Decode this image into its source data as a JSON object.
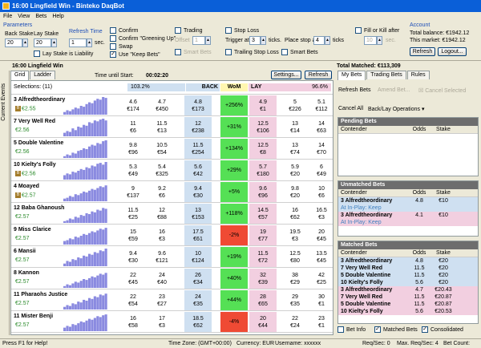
{
  "window": {
    "title": "16:00 Lingfield Win - Binteko DaqBot"
  },
  "menu": [
    "File",
    "View",
    "Bets",
    "Help"
  ],
  "toolbar": {
    "parameters_label": "Parameters",
    "back_stake_label": "Back Stake",
    "back_stake_value": "20",
    "lay_stake_label": "Lay Stake",
    "lay_stake_value": "20",
    "refresh_time_label": "Refresh Time",
    "refresh_time_value": "1",
    "sec_label": "sec.",
    "lay_is_liability": "Lay Stake is Liability",
    "confirm": "Confirm",
    "confirm_greening": "Confirm \"Greening Up\"",
    "swap": "Swap",
    "use_keep_bets": "Use \"Keep Bets\"",
    "trading": "Trading",
    "offset_label": "Offset",
    "offset_value": "1",
    "smart_bets_disabled": "Smart Bets",
    "stop_loss": "Stop Loss",
    "trigger_label": "Trigger at",
    "trigger_value": "3",
    "ticks_label": "ticks.",
    "place_stop_label": "Place stop at",
    "place_stop_value": "4",
    "ticks_label2": "ticks",
    "trailing_stop": "Trailing Stop Loss",
    "smart_bets": "Smart Bets",
    "fill_or_kill": "Fill or Kill after",
    "fok_value": "10",
    "fok_sec": "sec.",
    "account_label": "Account",
    "total_balance": "Total balance: €1942.12",
    "this_market": "This market: €1942.12",
    "refresh_btn": "Refresh",
    "logout_btn": "Logout..."
  },
  "market": {
    "name": "16:00 Lingfield Win",
    "total_matched": "Total Matched: €113,309"
  },
  "grid": {
    "tabs": [
      "Grid",
      "Ladder"
    ],
    "time_until_start_label": "Time until Start:",
    "time_until_start": "00:02:20",
    "settings_btn": "Settings...",
    "refresh_btn": "Refresh",
    "selections": "Selections: (11)",
    "back_pct": "103.2%",
    "back_label": "BACK",
    "wom_label": "WoM",
    "lay_label": "LAY",
    "lay_pct": "96.6%"
  },
  "runners": [
    {
      "name": "3 Alfredtheordinary",
      "pl": "€2.55",
      "badge": true,
      "back": [
        [
          "4.6",
          "€174"
        ],
        [
          "4.7",
          "€450"
        ],
        [
          "4.8",
          "€173"
        ]
      ],
      "wom": "+256%",
      "wom_sign": "pos",
      "lay": [
        [
          "4.9",
          "€1"
        ],
        [
          "5",
          "€226"
        ],
        [
          "5.1",
          "€112"
        ]
      ],
      "spark": [
        3,
        5,
        4,
        6,
        8,
        7,
        10,
        9,
        12,
        14,
        13,
        16,
        18,
        17,
        20,
        19
      ]
    },
    {
      "name": "7 Very Well Red",
      "pl": "€2.56",
      "badge": false,
      "back": [
        [
          "11",
          "€6"
        ],
        [
          "11.5",
          "€13"
        ],
        [
          "12",
          "€238"
        ]
      ],
      "wom": "+31%",
      "wom_sign": "pos",
      "lay": [
        [
          "12.5",
          "€106"
        ],
        [
          "13",
          "€14"
        ],
        [
          "14",
          "€63"
        ]
      ],
      "spark": [
        4,
        6,
        5,
        9,
        7,
        11,
        10,
        13,
        12,
        16,
        15,
        18,
        17,
        19,
        20,
        18
      ]
    },
    {
      "name": "5 Double Valentine",
      "pl": "€2.56",
      "badge": false,
      "back": [
        [
          "9.8",
          "€96"
        ],
        [
          "10.5",
          "€54"
        ],
        [
          "11.5",
          "€254"
        ]
      ],
      "wom": "+134%",
      "wom_sign": "pos",
      "lay": [
        [
          "12.5",
          "€8"
        ],
        [
          "13",
          "€74"
        ],
        [
          "14",
          "€70"
        ]
      ],
      "spark": [
        2,
        4,
        3,
        6,
        5,
        8,
        9,
        11,
        10,
        13,
        15,
        14,
        17,
        16,
        19,
        20
      ]
    },
    {
      "name": "10 Kielty's Folly",
      "pl": "€2.56",
      "badge": true,
      "back": [
        [
          "5.3",
          "€49"
        ],
        [
          "5.4",
          "€325"
        ],
        [
          "5.6",
          "€42"
        ]
      ],
      "wom": "+29%",
      "wom_sign": "pos",
      "lay": [
        [
          "5.7",
          "€180"
        ],
        [
          "5.9",
          "€20"
        ],
        [
          "6",
          "€49"
        ]
      ],
      "spark": [
        5,
        7,
        6,
        9,
        8,
        10,
        12,
        11,
        14,
        13,
        16,
        15,
        18,
        19,
        17,
        20
      ]
    },
    {
      "name": "4 Moayed",
      "pl": "€2.57",
      "badge": true,
      "back": [
        [
          "9",
          "€137"
        ],
        [
          "9.2",
          "€6"
        ],
        [
          "9.4",
          "€30"
        ]
      ],
      "wom": "+5%",
      "wom_sign": "pos",
      "lay": [
        [
          "9.6",
          "€96"
        ],
        [
          "9.8",
          "€20"
        ],
        [
          "10",
          "€6"
        ]
      ],
      "spark": [
        3,
        4,
        6,
        5,
        8,
        7,
        9,
        11,
        10,
        12,
        14,
        13,
        15,
        17,
        16,
        18
      ]
    },
    {
      "name": "12 Baba Ghanoush",
      "pl": "€2.57",
      "badge": false,
      "back": [
        [
          "11.5",
          "€25"
        ],
        [
          "12",
          "€88"
        ],
        [
          "13",
          "€153"
        ]
      ],
      "wom": "+118%",
      "wom_sign": "pos",
      "lay": [
        [
          "14.5",
          "€57"
        ],
        [
          "16",
          "€62"
        ],
        [
          "16.5",
          "€3"
        ]
      ],
      "spark": [
        2,
        3,
        5,
        4,
        7,
        6,
        9,
        8,
        11,
        10,
        13,
        12,
        15,
        14,
        17,
        16
      ]
    },
    {
      "name": "9 Miss Clarice",
      "pl": "€2.57",
      "badge": false,
      "back": [
        [
          "15",
          "€59"
        ],
        [
          "16",
          "€3"
        ],
        [
          "17.5",
          "€61"
        ]
      ],
      "wom": "-2%",
      "wom_sign": "neg",
      "lay": [
        [
          "19",
          "€77"
        ],
        [
          "19.5",
          "€3"
        ],
        [
          "20",
          "€45"
        ]
      ],
      "spark": [
        4,
        5,
        7,
        6,
        9,
        8,
        10,
        12,
        11,
        13,
        15,
        14,
        16,
        18,
        17,
        19
      ]
    },
    {
      "name": "6 Mansii",
      "pl": "€2.57",
      "badge": false,
      "back": [
        [
          "9.4",
          "€30"
        ],
        [
          "9.6",
          "€121"
        ],
        [
          "10",
          "€124"
        ]
      ],
      "wom": "+19%",
      "wom_sign": "pos",
      "lay": [
        [
          "11.5",
          "€72"
        ],
        [
          "12.5",
          "€80"
        ],
        [
          "13.5",
          "€45"
        ]
      ],
      "spark": [
        3,
        6,
        5,
        8,
        7,
        10,
        9,
        12,
        11,
        14,
        13,
        16,
        15,
        18,
        17,
        20
      ]
    },
    {
      "name": "8 Kannon",
      "pl": "€2.57",
      "badge": false,
      "back": [
        [
          "22",
          "€45"
        ],
        [
          "24",
          "€40"
        ],
        [
          "26",
          "€34"
        ]
      ],
      "wom": "+40%",
      "wom_sign": "pos",
      "lay": [
        [
          "32",
          "€39"
        ],
        [
          "38",
          "€29"
        ],
        [
          "42",
          "€25"
        ]
      ],
      "spark": [
        2,
        4,
        3,
        5,
        7,
        6,
        8,
        10,
        9,
        11,
        13,
        12,
        14,
        16,
        15,
        17
      ]
    },
    {
      "name": "11 Pharaohs Justice",
      "pl": "€2.57",
      "badge": false,
      "back": [
        [
          "22",
          "€54"
        ],
        [
          "23",
          "€27"
        ],
        [
          "24",
          "€35"
        ]
      ],
      "wom": "+44%",
      "wom_sign": "pos",
      "lay": [
        [
          "28",
          "€65"
        ],
        [
          "29",
          "€35"
        ],
        [
          "30",
          "€1"
        ]
      ],
      "spark": [
        3,
        5,
        4,
        7,
        6,
        9,
        8,
        11,
        10,
        13,
        12,
        15,
        14,
        17,
        16,
        18
      ]
    },
    {
      "name": "11 Mister Benji",
      "pl": "€2.57",
      "badge": false,
      "back": [
        [
          "16",
          "€58"
        ],
        [
          "17",
          "€3"
        ],
        [
          "18.5",
          "€62"
        ]
      ],
      "wom": "-4%",
      "wom_sign": "neg",
      "lay": [
        [
          "20",
          "€44"
        ],
        [
          "22",
          "€24"
        ],
        [
          "23",
          "€1"
        ]
      ],
      "spark": [
        4,
        6,
        5,
        8,
        7,
        9,
        11,
        10,
        12,
        14,
        13,
        15,
        17,
        16,
        18,
        19
      ]
    }
  ],
  "right": {
    "tabs": [
      "My Bets",
      "Trading Bets",
      "Rules"
    ],
    "refresh_bets": "Refresh Bets",
    "amend_bet": "Amend Bet...",
    "cancel_selected": "Cancel Selected",
    "cancel_all": "Cancel All",
    "back_lay_ops": "Back/Lay Operations",
    "pending_title": "Pending Bets",
    "col_contender": "Contender",
    "col_odds": "Odds",
    "col_stake": "Stake",
    "unmatched_title": "Unmatched Bets",
    "unmatched": [
      {
        "type": "b",
        "name": "3 Alfredtheordinary",
        "odds": "4.8",
        "stake": "€10",
        "sub": "At In-Play: Keep"
      },
      {
        "type": "l",
        "name": "3 Alfredtheordinary",
        "odds": "4.1",
        "stake": "€10",
        "sub": "At In-Play: Keep"
      }
    ],
    "matched_title": "Matched Bets",
    "matched": [
      {
        "type": "b",
        "name": "3 Alfredtheordinary",
        "odds": "4.8",
        "stake": "€20"
      },
      {
        "type": "b",
        "name": "7 Very Well Red",
        "odds": "11.5",
        "stake": "€20"
      },
      {
        "type": "b",
        "name": "5 Double Valentine",
        "odds": "11.5",
        "stake": "€20"
      },
      {
        "type": "b",
        "name": "10 Kielty's Folly",
        "odds": "5.6",
        "stake": "€20"
      },
      {
        "type": "l",
        "name": "3 Alfredtheordinary",
        "odds": "4.7",
        "stake": "€20.43"
      },
      {
        "type": "l",
        "name": "7 Very Well Red",
        "odds": "11.5",
        "stake": "€20.87"
      },
      {
        "type": "l",
        "name": "5 Double Valentine",
        "odds": "11.5",
        "stake": "€20.87"
      },
      {
        "type": "l",
        "name": "10 Kielty's Folly",
        "odds": "5.6",
        "stake": "€20.53"
      }
    ],
    "bet_info": "Bet Info",
    "matched_bets": "Matched Bets",
    "consolidated": "Consolidated"
  },
  "vertical_tab": "Current Events",
  "status": {
    "help": "Press F1 for Help!",
    "timezone": "Time Zone: (GMT+00:00)",
    "currency": "Currency: EUR",
    "username": "Username: xxxxxx",
    "req_sec": "Req/Sec: 0",
    "max_req": "Max. Req/Sec: 4",
    "bet_count": "Bet Count:"
  },
  "colors": {
    "back": "#cfe0f1",
    "lay": "#f2cfe0",
    "wom_pos": "#55e055",
    "wom_neg": "#ef4a34",
    "title": "#0a5fd8",
    "spark": "#8a8ae0"
  }
}
